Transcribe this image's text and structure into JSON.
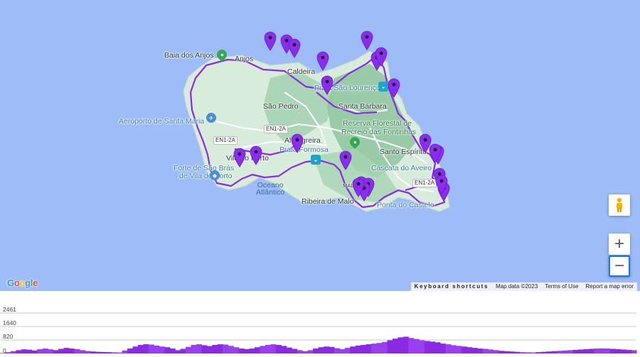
{
  "map": {
    "places": [
      {
        "id": "baia-dos-anjos",
        "label": "Baia dos Anjos",
        "style": "dark"
      },
      {
        "id": "anjos",
        "label": "Anjos",
        "style": "dark"
      },
      {
        "id": "caldeira",
        "label": "Caldeira",
        "style": "dark"
      },
      {
        "id": "praia-sao-lourenco",
        "label": "Praia São Lourenço",
        "style": "blue"
      },
      {
        "id": "sao-pedro",
        "label": "São Pedro",
        "style": "dark"
      },
      {
        "id": "santa-barbara",
        "label": "Santa Bárbara",
        "style": "dark"
      },
      {
        "id": "aeroporto",
        "label": "Aeroporto de Santa Maria",
        "style": "blue"
      },
      {
        "id": "reserva-1",
        "label": "Reserva Florestal de",
        "style": "green"
      },
      {
        "id": "reserva-2",
        "label": "Recreio das Fontinhas",
        "style": "green"
      },
      {
        "id": "almagreira",
        "label": "Almagreira",
        "style": "dark"
      },
      {
        "id": "praia-formosa",
        "label": "Praia Formosa",
        "style": "blue"
      },
      {
        "id": "santo-espirito",
        "label": "Santo Espírito",
        "style": "dark"
      },
      {
        "id": "vila-do-porto",
        "label": "Vila do Porto",
        "style": "dark"
      },
      {
        "id": "forte-1",
        "label": "Forte de São Brás",
        "style": "blue"
      },
      {
        "id": "forte-2",
        "label": "de Vila do Porto",
        "style": "blue"
      },
      {
        "id": "cascata",
        "label": "Cascata do Aveiro",
        "style": "blue"
      },
      {
        "id": "malbusca",
        "label": "MALBUSCA",
        "style": "dark"
      },
      {
        "id": "ribeira-de-malo",
        "label": "Ribeira de Malo",
        "style": "dark"
      },
      {
        "id": "ponta-do-castelo",
        "label": "Ponta do Castelo",
        "style": "blue"
      }
    ],
    "ocean_label": {
      "line1": "Oceano",
      "line2": "Atlântico"
    },
    "road_shields": [
      "EN1-2A",
      "EN1-2A",
      "EN1-2A"
    ],
    "colors": {
      "water": "#9ebcf7",
      "land": "#d5ead9",
      "route": "#8a2be2",
      "marker": "#8b2cf0"
    },
    "marker_count": 26
  },
  "controls": {
    "zoom_in": "+",
    "zoom_out": "−",
    "google_logo": [
      "G",
      "o",
      "o",
      "g",
      "l",
      "e"
    ],
    "keyboard_shortcuts": "Keyboard shortcuts",
    "map_data": "Map data ©2023",
    "terms": "Terms of Use",
    "report": "Report a map error"
  },
  "elevation": {
    "labels": [
      "2461",
      "1640",
      "820",
      "0"
    ],
    "max": 2461,
    "profile": [
      30,
      80,
      140,
      200,
      250,
      230,
      180,
      260,
      300,
      250,
      200,
      280,
      340,
      300,
      260,
      200,
      150,
      120,
      100,
      90,
      80,
      70,
      60,
      180,
      300,
      420,
      520,
      560,
      540,
      480,
      420,
      380,
      300,
      200,
      280,
      400,
      520,
      560,
      500,
      450,
      520,
      560,
      540,
      460,
      380,
      300,
      260,
      300,
      380,
      460,
      520,
      560,
      520,
      460,
      360,
      280,
      200,
      140,
      200,
      300,
      380,
      420,
      400,
      320,
      260,
      340,
      420,
      480,
      520,
      560,
      600,
      640,
      700,
      800,
      900,
      980,
      1020,
      940,
      880,
      800,
      760,
      720,
      680,
      600,
      560,
      500,
      460,
      420,
      380,
      340,
      300,
      280,
      240,
      200,
      160,
      140,
      120,
      100,
      80,
      70,
      60,
      80,
      100,
      120,
      140,
      160,
      180,
      200,
      220,
      240,
      260,
      280,
      300,
      310,
      300,
      280,
      260,
      240,
      220,
      200
    ]
  }
}
